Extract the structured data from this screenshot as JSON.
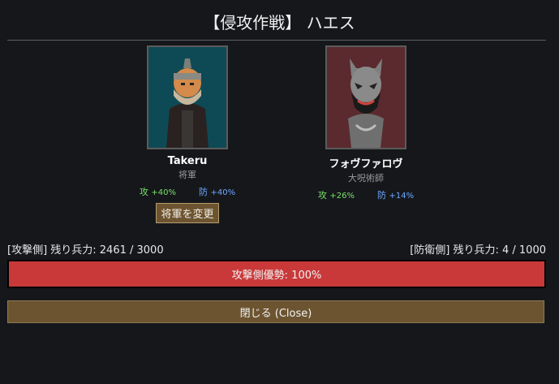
{
  "dialog": {
    "title": "【侵攻作戦】 ハエス"
  },
  "attacker": {
    "name": "Takeru",
    "role": "将軍",
    "atk_label": "攻",
    "atk_value": "+40%",
    "def_label": "防",
    "def_value": "+40%",
    "change_button": "将軍を変更",
    "forces": "[攻撃側] 残り兵力: 2461 / 3000"
  },
  "defender": {
    "name": "フォヴファロヴ",
    "role": "大呪術師",
    "atk_label": "攻",
    "atk_value": "+26%",
    "def_label": "防",
    "def_value": "+14%",
    "forces": "[防衛側] 残り兵力: 4 / 1000"
  },
  "advantage": {
    "label": "攻撃側優勢: 100%",
    "attacker_share": 1.0,
    "color": "#c9393a"
  },
  "close_button": "閉じる (Close)",
  "colors": {
    "attack_stat": "#7be06a",
    "defense_stat": "#6ea8ff",
    "button_brown": "#6c5430"
  }
}
